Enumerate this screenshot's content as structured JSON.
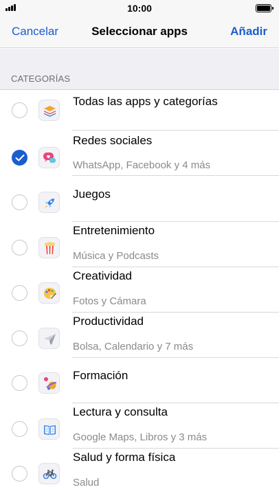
{
  "status_bar": {
    "time": "10:00"
  },
  "nav": {
    "cancel_label": "Cancelar",
    "title": "Seleccionar apps",
    "add_label": "Añadir"
  },
  "section": {
    "header": "CATEGORÍAS"
  },
  "colors": {
    "accent": "#1a5dcf",
    "separator": "#d8d8d8",
    "section_background": "#efeff4"
  },
  "categories": [
    {
      "title": "Todas las apps y categorías",
      "subtitle": "",
      "selected": false,
      "icon": "stack-icon"
    },
    {
      "title": "Redes sociales",
      "subtitle": "WhatsApp, Facebook y 4 más",
      "selected": true,
      "icon": "chat-heart-icon"
    },
    {
      "title": "Juegos",
      "subtitle": "",
      "selected": false,
      "icon": "rocket-icon"
    },
    {
      "title": "Entretenimiento",
      "subtitle": "Música y Podcasts",
      "selected": false,
      "icon": "popcorn-icon"
    },
    {
      "title": "Creatividad",
      "subtitle": "Fotos y Cámara",
      "selected": false,
      "icon": "palette-icon"
    },
    {
      "title": "Productividad",
      "subtitle": "Bolsa, Calendario y 7 más",
      "selected": false,
      "icon": "paper-plane-icon"
    },
    {
      "title": "Formación",
      "subtitle": "",
      "selected": false,
      "icon": "planet-icon"
    },
    {
      "title": "Lectura y consulta",
      "subtitle": "Google Maps, Libros y 3 más",
      "selected": false,
      "icon": "book-icon"
    },
    {
      "title": "Salud y forma física",
      "subtitle": "Salud",
      "selected": false,
      "icon": "bicycle-icon"
    }
  ]
}
